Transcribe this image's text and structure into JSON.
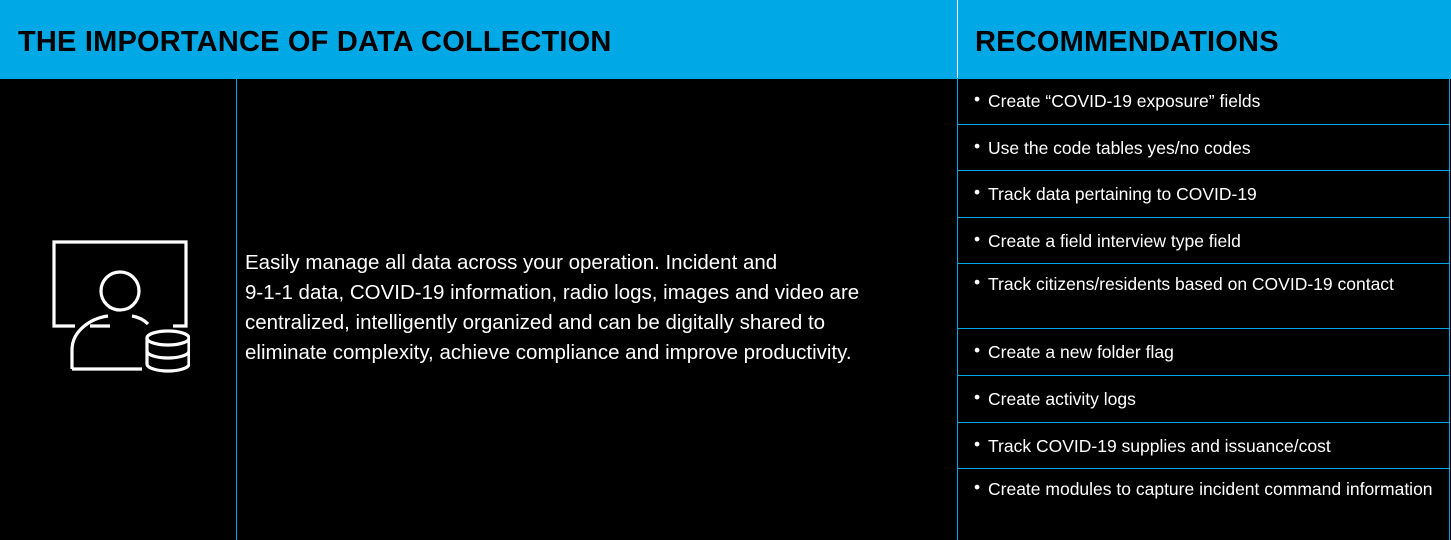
{
  "header": {
    "left_title": "THE IMPORTANCE OF DATA COLLECTION",
    "right_title": "RECOMMENDATIONS"
  },
  "colors": {
    "accent": "#00a8e6",
    "background": "#000000",
    "text": "#ffffff"
  },
  "icon": "user-database-icon",
  "description": {
    "line1": "Easily manage all data across your operation. Incident and",
    "line2": "9-1-1 data, COVID-19 information, radio logs, images and video are",
    "line3": "centralized, intelligently organized and can be digitally shared to",
    "line4": "eliminate complexity, achieve compliance and improve productivity."
  },
  "recommendations": [
    "Create “COVID-19 exposure” fields",
    "Use the code tables yes/no codes",
    "Track data pertaining to COVID-19",
    "Create a field interview type field",
    "Track citizens/residents based on COVID-19 contact",
    "Create a new folder flag",
    "Create activity logs",
    "Track COVID-19 supplies and issuance/cost",
    "Create modules to capture incident command information"
  ],
  "bullet": "•"
}
